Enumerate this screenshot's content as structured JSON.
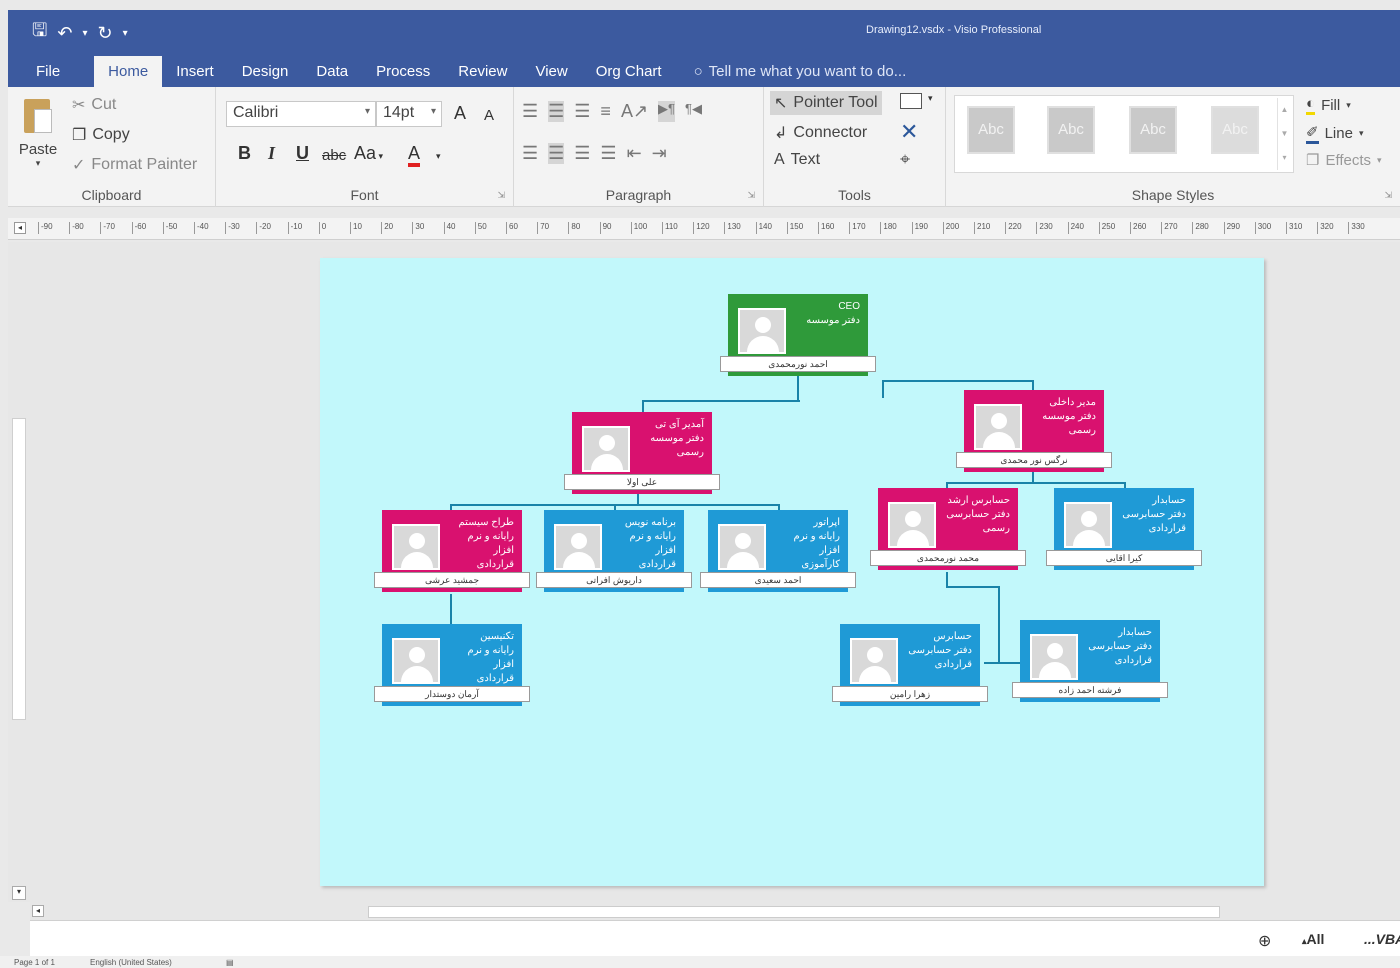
{
  "window": {
    "title": "Drawing12.vsdx - Visio Professional",
    "qat": {
      "save_icon": "save-icon",
      "undo_icon": "undo-icon",
      "redo_icon": "redo-icon"
    }
  },
  "tabs": [
    {
      "label": "File"
    },
    {
      "label": "Home"
    },
    {
      "label": "Insert"
    },
    {
      "label": "Design"
    },
    {
      "label": "Data"
    },
    {
      "label": "Process"
    },
    {
      "label": "Review"
    },
    {
      "label": "View"
    },
    {
      "label": "Org Chart"
    }
  ],
  "tell_me": "Tell me what you want to do...",
  "clipboard": {
    "paste": "Paste",
    "cut": "Cut",
    "copy": "Copy",
    "format_painter": "Format Painter",
    "label": "Clipboard"
  },
  "font": {
    "family": "Calibri",
    "size": "14pt",
    "grow": "A",
    "shrink": "A",
    "bold": "B",
    "italic": "I",
    "underline": "U",
    "strike": "abc",
    "case": "Aa",
    "color_a": "A",
    "label": "Font"
  },
  "paragraph": {
    "label": "Paragraph"
  },
  "tools": {
    "pointer": "Pointer Tool",
    "connector": "Connector",
    "text": "Text",
    "label": "Tools"
  },
  "shape_styles": {
    "swatch": "Abc",
    "fill": "Fill",
    "line": "Line",
    "effects": "Effects",
    "label": "Shape Styles"
  },
  "ruler": [
    "-90",
    "-80",
    "-70",
    "-60",
    "-50",
    "-40",
    "-30",
    "-20",
    "-10",
    "0",
    "10",
    "20",
    "30",
    "40",
    "50",
    "60",
    "70",
    "80",
    "90",
    "100",
    "110",
    "120",
    "130",
    "140",
    "150",
    "160",
    "170",
    "180",
    "190",
    "200",
    "210",
    "220",
    "230",
    "240",
    "250",
    "260",
    "270",
    "280",
    "290",
    "300",
    "310",
    "320",
    "330"
  ],
  "org": {
    "ceo": {
      "lines": [
        "CEO",
        "دفتر موسسه"
      ],
      "name": "احمد نورمحمدی"
    },
    "it_manager": {
      "lines": [
        "آمدیر آی تی",
        "دفتر موسسه",
        "رسمی"
      ],
      "name": "علی اولا"
    },
    "internal_manager": {
      "lines": [
        "مدیر داخلی",
        "دفتر موسسه",
        "رسمی"
      ],
      "name": "نرگس نور محمدی"
    },
    "designer": {
      "lines": [
        "طراح سیستم",
        "رایانه و نرم",
        "افزار",
        "قراردادی"
      ],
      "name": "جمشید عرشی"
    },
    "programmer": {
      "lines": [
        "برنامه نویس",
        "رایانه و نرم",
        "افزار",
        "قراردادی"
      ],
      "name": "داریوش افراتی"
    },
    "operator": {
      "lines": [
        "اپراتور",
        "رایانه و نرم",
        "افزار",
        "کارآموزی"
      ],
      "name": "احمد سعیدی"
    },
    "lead_auditor": {
      "lines": [
        "حسابرس ارشد",
        "دفتر حسابرسی",
        "رسمی"
      ],
      "name": "محمد نورمحمدی"
    },
    "accountant": {
      "lines": [
        "حسابدار",
        "دفتر حسابرسی",
        "قراردادی"
      ],
      "name": "کیرا اقایی"
    },
    "technician": {
      "lines": [
        "تکنیسین",
        "رایانه و نرم",
        "افزار",
        "قراردادی"
      ],
      "name": "آرمان دوستدار"
    },
    "auditor": {
      "lines": [
        "حسابرس",
        "دفتر حسابرسی",
        "قراردادی"
      ],
      "name": "زهرا رامین"
    },
    "accountant2": {
      "lines": [
        "حسابدار",
        "دفتر حسابرسی",
        "قراردادی"
      ],
      "name": "فرشته احمد زاده"
    }
  },
  "pagebar": {
    "all": "All",
    "vba": "...VBA"
  },
  "status": {
    "page": "Page 1 of 1",
    "language": "English (United States)"
  }
}
